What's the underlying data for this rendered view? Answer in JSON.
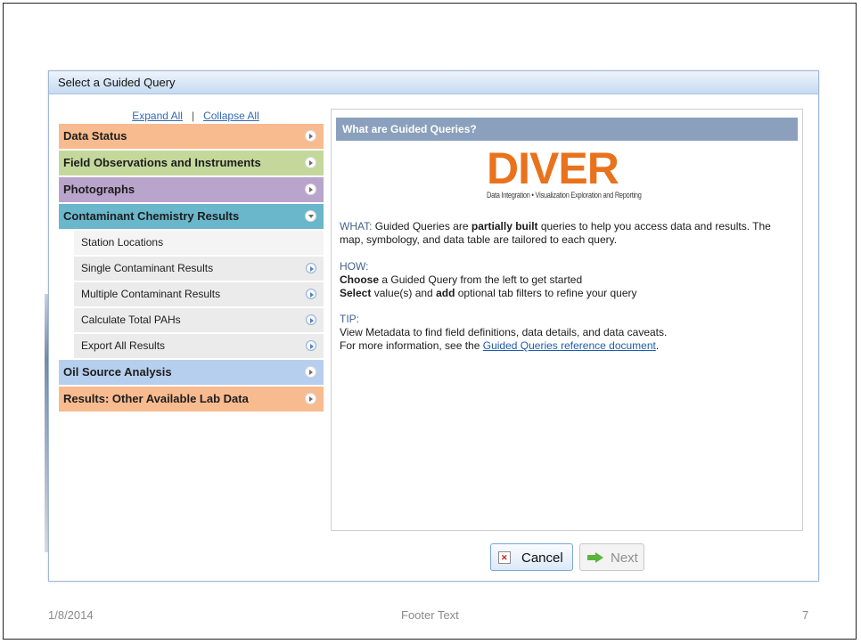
{
  "dialog": {
    "title": "Select a Guided Query",
    "expand_all": "Expand All",
    "separator": "|",
    "collapse_all": "Collapse All"
  },
  "categories": [
    {
      "label": "Data Status",
      "color": "#f8bb8f"
    },
    {
      "label": "Field Observations and Instruments",
      "color": "#c4d89b"
    },
    {
      "label": "Photographs",
      "color": "#b9a4cc"
    },
    {
      "label": "Contaminant Chemistry Results",
      "color": "#6ab6cb"
    },
    {
      "label": "Oil Source Analysis",
      "color": "#b7cfee"
    },
    {
      "label": "Results: Other Available Lab Data",
      "color": "#f8bb8f"
    }
  ],
  "subitems": [
    "Station Locations",
    "Single Contaminant Results",
    "Multiple Contaminant Results",
    "Calculate Total PAHs",
    "Export All Results"
  ],
  "info": {
    "header": "What are Guided Queries?",
    "logo_text": "DIVER",
    "logo_tagline": "Data Integration • Visualization Exploration and Reporting",
    "what_label": "WHAT:",
    "what_text_1": " Guided Queries are ",
    "what_bold": "partially built",
    "what_text_2": " queries to help you access data and results. The map, symbology, and data table are tailored to each query.",
    "how_label": "HOW:",
    "how_line1_bold": "Choose",
    "how_line1_rest": " a Guided Query from the left to get started",
    "how_line2_bold1": "Select",
    "how_line2_mid": " value(s) and ",
    "how_line2_bold2": "add",
    "how_line2_rest": " optional tab filters to refine your query",
    "tip_label": "TIP:",
    "tip_line1": "View Metadata to find field definitions, data details, and data caveats.",
    "tip_line2_pre": "For more information, see the ",
    "tip_link": "Guided Queries reference document",
    "tip_line2_post": "."
  },
  "buttons": {
    "cancel": "Cancel",
    "next": "Next"
  },
  "footer": {
    "date": "1/8/2014",
    "text": "Footer Text",
    "page": "7"
  }
}
